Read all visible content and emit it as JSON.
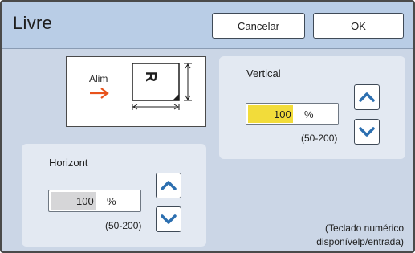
{
  "header": {
    "title": "Livre",
    "cancel_label": "Cancelar",
    "ok_label": "OK"
  },
  "diagram": {
    "feed_label": "Alim",
    "paper_letter": "R"
  },
  "vertical": {
    "label": "Vertical",
    "value": "100",
    "unit": "%",
    "range": "(50-200)",
    "highlight_color": "#f2dc3a"
  },
  "horizontal": {
    "label": "Horizont",
    "value": "100",
    "unit": "%",
    "range": "(50-200)",
    "highlight_color": "#d6d6d8"
  },
  "footnote": {
    "line1": "(Teclado numérico",
    "line2": "disponívelp/entrada)"
  },
  "icons": {
    "up": "chevron-up-icon",
    "down": "chevron-down-icon",
    "feed": "arrow-right-icon"
  },
  "colors": {
    "accent_arrow": "#e8531c",
    "chevron": "#2c6fb0"
  }
}
